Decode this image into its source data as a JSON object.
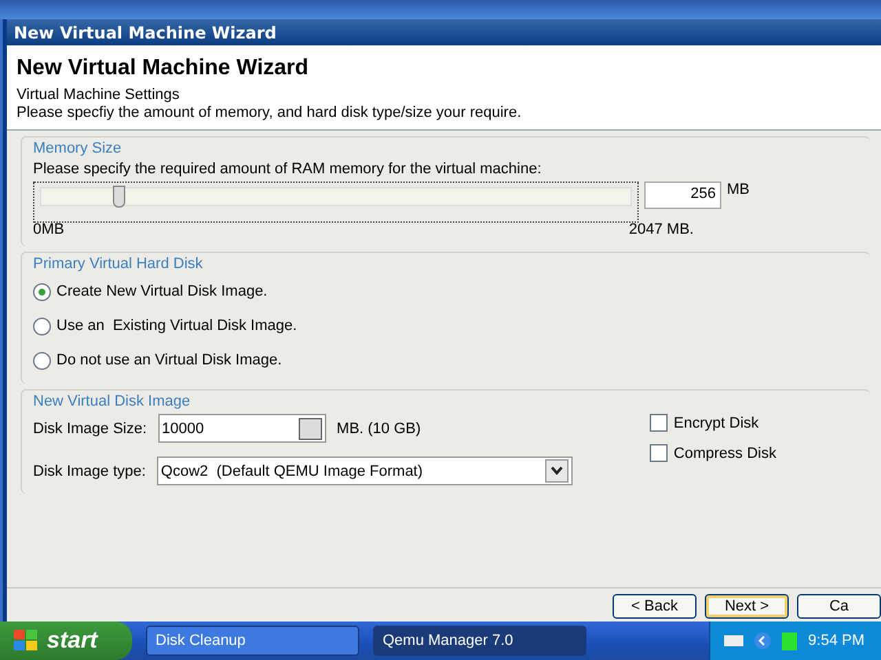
{
  "window": {
    "title": "New Virtual Machine Wizard"
  },
  "header": {
    "title": "New Virtual Machine Wizard",
    "subtitle": "Virtual Machine Settings",
    "description": "Please specfiy the amount of memory, and hard disk type/size your require."
  },
  "memory": {
    "legend": "Memory Size",
    "prompt": "Please specify the required amount of RAM memory for the virtual machine:",
    "level": 0.125,
    "value": "256",
    "unit": "MB",
    "min_label": "0MB",
    "max_label": "2047 MB."
  },
  "disk": {
    "legend": "Primary Virtual Hard Disk",
    "options": [
      {
        "label": "Create New Virtual Disk Image.",
        "selected": true
      },
      {
        "label": "Use an  Existing Virtual Disk Image.",
        "selected": false
      },
      {
        "label": "Do not use an Virtual Disk Image.",
        "selected": false
      }
    ]
  },
  "new_image": {
    "legend": "New Virtual Disk Image",
    "size_label": "Disk Image Size:",
    "size_value": "10000",
    "size_unit": "MB. (10 GB)",
    "type_label": "Disk Image type:",
    "type_value": "Qcow2  (Default QEMU Image Format)",
    "checkboxes": [
      {
        "label": "Encrypt Disk",
        "checked": false
      },
      {
        "label": "Compress Disk",
        "checked": false
      }
    ]
  },
  "buttons": [
    {
      "label": "< Back",
      "default": false
    },
    {
      "label": "Next >",
      "default": true
    },
    {
      "label": "Ca",
      "default": false
    }
  ],
  "taskbar": {
    "start": "start",
    "tasks": [
      {
        "label": "Disk Cleanup",
        "selected": false
      },
      {
        "label": "Qemu Manager 7.0",
        "selected": true
      }
    ],
    "clock": "9:54 PM"
  }
}
